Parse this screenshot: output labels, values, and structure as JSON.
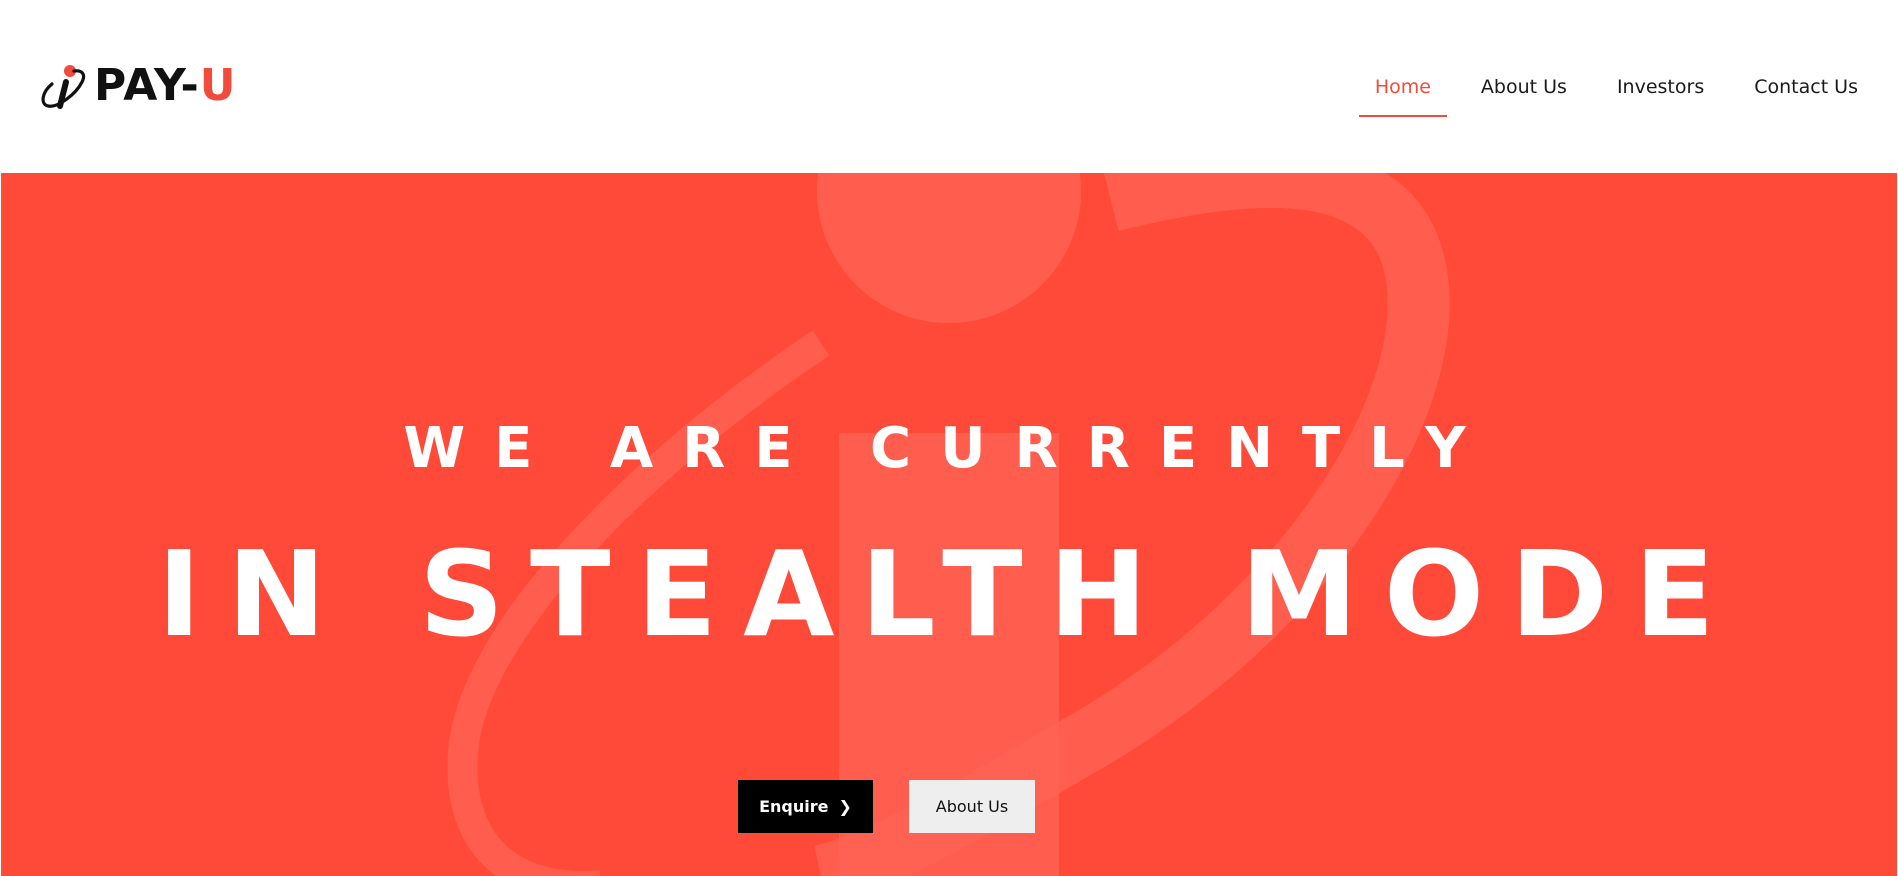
{
  "brand": {
    "name_main": "PAY-",
    "name_accent": "U",
    "accent_color": "#f04b3b",
    "logo_icon": "info-i-orbit-icon"
  },
  "nav": {
    "items": [
      {
        "label": "Home",
        "active": true
      },
      {
        "label": "About Us",
        "active": false
      },
      {
        "label": "Investors",
        "active": false
      },
      {
        "label": "Contact Us",
        "active": false
      }
    ]
  },
  "hero": {
    "background_color": "#ff4a3a",
    "watermark_icon": "info-i-orbit-icon",
    "subtitle": "WE ARE CURRENTLY",
    "title": "IN STEALTH MODE",
    "buttons": {
      "enquire_label": "Enquire",
      "enquire_icon": "chevron-right-icon",
      "about_label": "About Us"
    }
  }
}
